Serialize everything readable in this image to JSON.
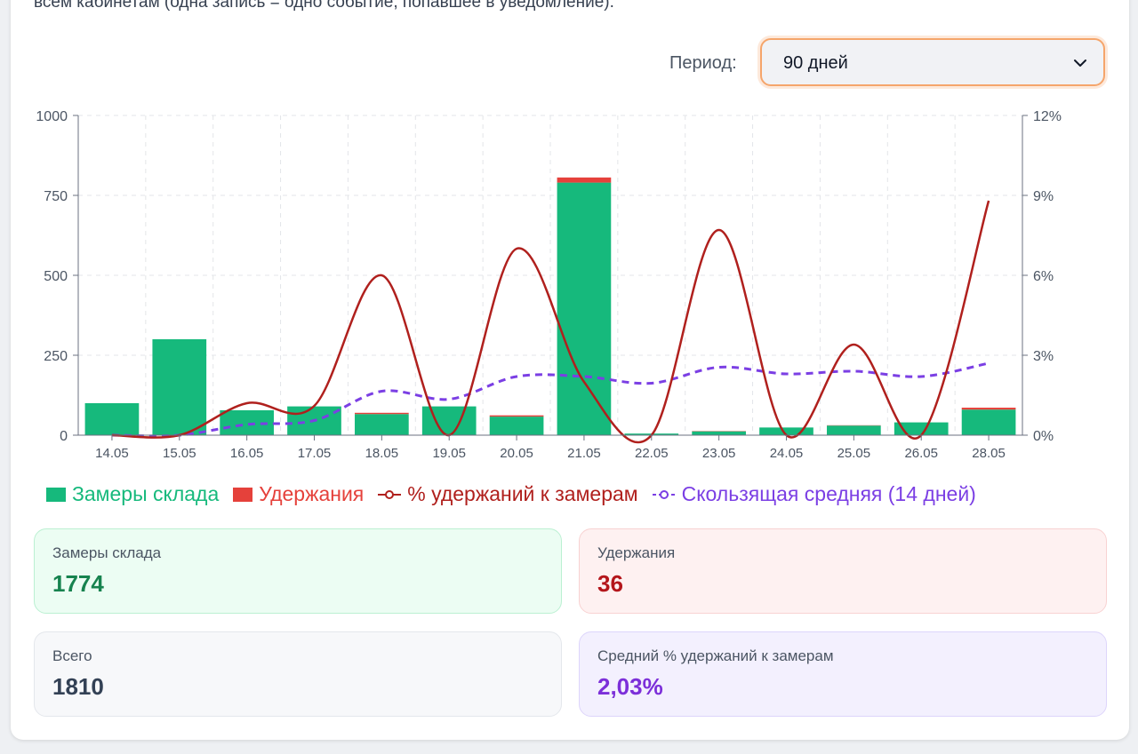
{
  "description": "всем кабинетам (одна запись = одно событие, попавшее в уведомление).",
  "period": {
    "label": "Период:",
    "value": "90 дней",
    "icon": "chevron-down-icon"
  },
  "colors": {
    "bar_main": "#16b97c",
    "bar_hold": "#e5413b",
    "line_pct": "#b0201d",
    "line_avg": "#7b3fe4",
    "grid": "#e3e5e8",
    "axis_text": "#4b5563"
  },
  "chart_data": {
    "type": "bar",
    "categories": [
      "14.05",
      "15.05",
      "16.05",
      "17.05",
      "18.05",
      "19.05",
      "20.05",
      "21.05",
      "22.05",
      "23.05",
      "24.05",
      "25.05",
      "26.05",
      "28.05"
    ],
    "series": [
      {
        "name": "Замеры склада",
        "type": "bar",
        "axis": "left",
        "stack": "s",
        "values": [
          100,
          300,
          78,
          90,
          66,
          90,
          58,
          790,
          5,
          12,
          24,
          30,
          40,
          80
        ]
      },
      {
        "name": "Удержания",
        "type": "bar",
        "axis": "left",
        "stack": "s",
        "values": [
          0,
          0,
          0,
          0,
          4,
          0,
          4,
          16,
          0,
          1,
          0,
          1,
          0,
          6
        ]
      },
      {
        "name": "% удержаний к замерам",
        "type": "line",
        "axis": "right",
        "values": [
          0,
          0,
          1.2,
          1.1,
          6.0,
          0,
          7.0,
          2.0,
          0,
          7.7,
          0,
          3.4,
          0,
          8.8
        ]
      },
      {
        "name": "Скользящая средняя (14 дней)",
        "type": "line",
        "dashed": true,
        "axis": "right",
        "values": [
          0,
          0,
          0.4,
          0.55,
          1.65,
          1.35,
          2.2,
          2.2,
          1.95,
          2.55,
          2.3,
          2.4,
          2.2,
          2.7
        ]
      }
    ],
    "y_left": {
      "ticks": [
        "0",
        "250",
        "500",
        "750",
        "1000"
      ],
      "range": [
        0,
        1000
      ]
    },
    "y_right": {
      "ticks": [
        "0%",
        "3%",
        "6%",
        "9%",
        "12%"
      ],
      "range": [
        0,
        12
      ]
    },
    "grid": true,
    "legend_position": "bottom"
  },
  "stats": {
    "zamery": {
      "label": "Замеры склада",
      "value": "1774",
      "color": "#17834f"
    },
    "uderzh": {
      "label": "Удержания",
      "value": "36",
      "color": "#b4161b"
    },
    "total": {
      "label": "Всего",
      "value": "1810",
      "color": "#334155"
    },
    "avg": {
      "label": "Средний % удержаний к замерам",
      "value": "2,03%",
      "color": "#7c2fd9"
    }
  }
}
